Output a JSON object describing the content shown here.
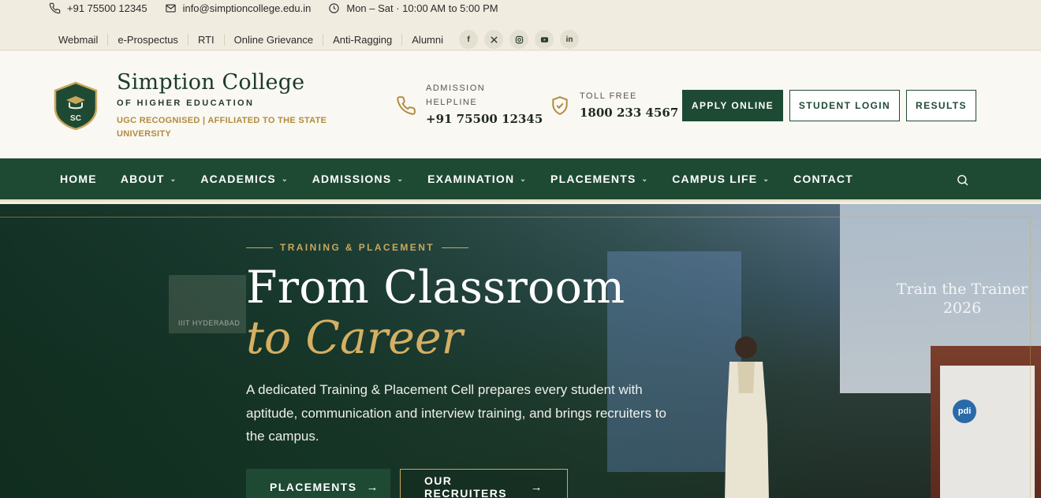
{
  "topbar": {
    "phone": "+91 75500 12345",
    "email": "info@simptioncollege.edu.in",
    "hours": "Mon – Sat · 10:00 AM to 5:00 PM",
    "links": [
      "Webmail",
      "e-Prospectus",
      "RTI",
      "Online Grievance",
      "Anti-Ragging",
      "Alumni"
    ],
    "socials": [
      "facebook-icon",
      "x-icon",
      "instagram-icon",
      "youtube-icon",
      "linkedin-icon"
    ]
  },
  "header": {
    "logo_initials": "SC",
    "college_name": "Simption College",
    "subtitle": "OF HIGHER EDUCATION",
    "tagline": "UGC RECOGNISED | AFFILIATED TO THE STATE UNIVERSITY",
    "helpline_label_1": "ADMISSION",
    "helpline_label_2": "HELPLINE",
    "helpline_number": "+91 75500 12345",
    "tollfree_label": "TOLL FREE",
    "tollfree_number": "1800 233 4567",
    "apply_label": "APPLY ONLINE",
    "login_label": "STUDENT LOGIN",
    "results_label": "RESULTS"
  },
  "nav": {
    "items": [
      {
        "label": "HOME",
        "dropdown": false
      },
      {
        "label": "ABOUT",
        "dropdown": true
      },
      {
        "label": "ACADEMICS",
        "dropdown": true
      },
      {
        "label": "ADMISSIONS",
        "dropdown": true
      },
      {
        "label": "EXAMINATION",
        "dropdown": true
      },
      {
        "label": "PLACEMENTS",
        "dropdown": true
      },
      {
        "label": "CAMPUS LIFE",
        "dropdown": true
      },
      {
        "label": "CONTACT",
        "dropdown": false
      }
    ],
    "chevron": "⌄"
  },
  "hero": {
    "eyebrow": "TRAINING & PLACEMENT",
    "title": "From Classroom",
    "title_accent": "to Career",
    "text": "A dedicated Training & Placement Cell prepares every student with aptitude, communication and interview training, and brings recruiters to the campus.",
    "button_primary": "PLACEMENTS",
    "button_secondary": "OUR RECRUITERS",
    "arrow": "→",
    "screen_title": "Train the Trainer 2026",
    "wall_sign": "IIIT HYDERABAD",
    "podium_logo": "pdi"
  },
  "colors": {
    "primary_green": "#1e4a34",
    "gold": "#c9a85c",
    "cream": "#f3efe4"
  }
}
